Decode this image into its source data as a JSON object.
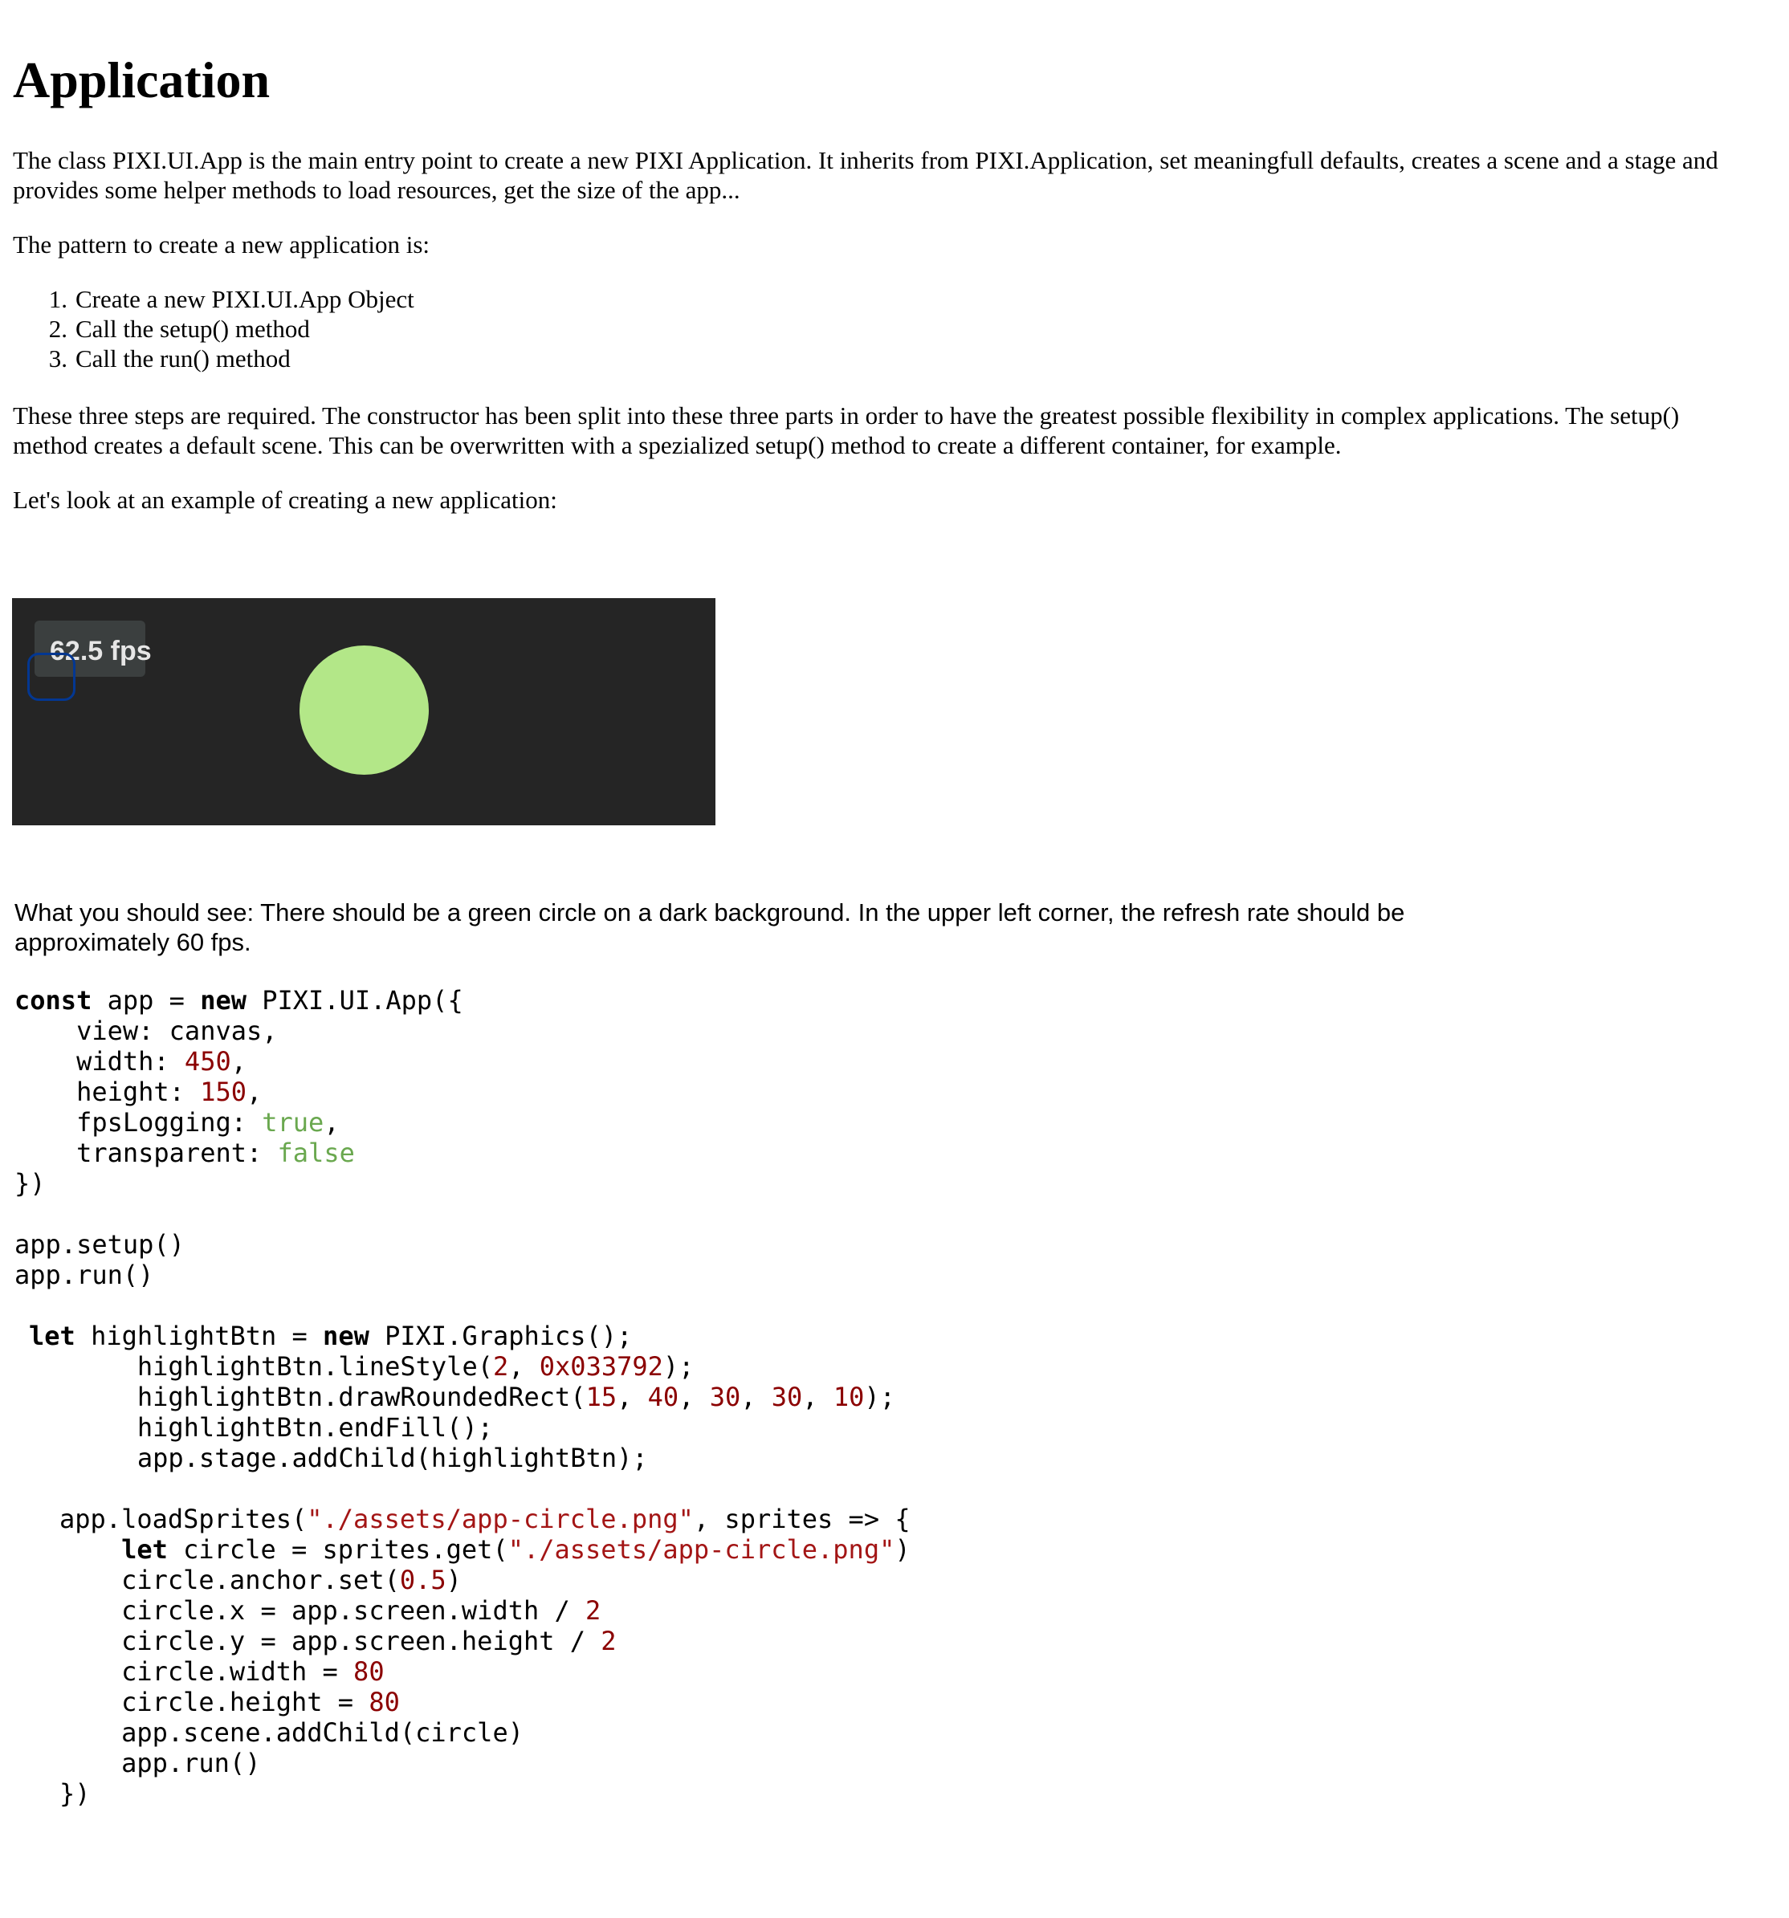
{
  "heading": "Application",
  "paragraphs": {
    "intro": "The class PIXI.UI.App is the main entry point to create a new PIXI Application. It inherits from PIXI.Application, set meaningfull defaults, creates a scene and a stage and provides some helper methods to load resources, get the size of the app...",
    "pattern": "The pattern to create a new application is:",
    "required": "These three steps are required. The constructor has been split into these three parts in order to have the greatest possible flexibility in complex applications. The setup() method creates a default scene. This can be overwritten with a spezialized setup() method to create a different container, for example.",
    "example": "Let's look at an example of creating a new application:"
  },
  "steps": [
    {
      "number": "1.",
      "text": "Create a new PIXI.UI.App Object"
    },
    {
      "number": "2.",
      "text": "Call the setup() method"
    },
    {
      "number": "3.",
      "text": "Call the run() method"
    }
  ],
  "demo": {
    "fps_label": "62.5 fps",
    "background_color": "#252525",
    "circle_color": "#b3e788",
    "highlight_color": "#033792"
  },
  "description": "What you should see: There should be a green circle on a dark background. In the upper left corner, the refresh rate should be approximately 60 fps.",
  "code": {
    "app": {
      "kw_const": "const",
      "app_var": " app = ",
      "kw_new": "new",
      "ctor": " PIXI.UI.App({\n    view: canvas,\n    width: ",
      "width": "450",
      "sep1": ",\n    height: ",
      "height": "150",
      "sep2": ",\n    fpsLogging: ",
      "fps_logging": "true",
      "sep3": ",\n    transparent: ",
      "transparent": "false",
      "tail": "\n})\n\napp.setup()\napp.run()"
    },
    "highlight": {
      "kw_let": "let",
      "decl": " highlightBtn = ",
      "kw_new": "new",
      "ctor": " PIXI.Graphics();\n       highlightBtn.lineStyle(",
      "line_width": "2",
      "comma1": ", ",
      "line_color": "0x033792",
      "rect_open": ");\n       highlightBtn.drawRoundedRect(",
      "rect_x": "15",
      "comma2": ", ",
      "rect_y": "40",
      "comma3": ", ",
      "rect_w": "30",
      "comma4": ", ",
      "rect_h": "30",
      "comma5": ", ",
      "rect_r": "10",
      "tail": ");\n       highlightBtn.endFill();\n       app.stage.addChild(highlightBtn);"
    },
    "load": {
      "call": "app.loadSprites(",
      "path1": "\"./assets/app-circle.png\"",
      "cb": ", sprites => {\n    ",
      "kw_let": "let",
      "get": " circle = sprites.get(",
      "path2": "\"./assets/app-circle.png\"",
      "anchor": ")\n    circle.anchor.set(",
      "anchor_val": "0.5",
      "x_line": ")\n    circle.x = app.screen.width / ",
      "x_div": "2",
      "y_line": "\n    circle.y = app.screen.height / ",
      "y_div": "2",
      "w_line": "\n    circle.width = ",
      "w_val": "80",
      "h_line": "\n    circle.height = ",
      "h_val": "80",
      "tail": "\n    app.scene.addChild(circle)\n    app.run()\n})"
    }
  }
}
